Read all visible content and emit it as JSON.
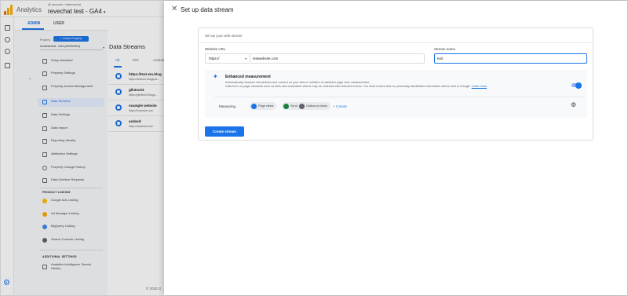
{
  "app": {
    "name": "Analytics",
    "breadcrumb": "All accounts > testrevechat",
    "property_title": "revechat test - GA4",
    "brand_colors": {
      "primary": "#1a73e8",
      "logo_orange": "#f9ab00",
      "logo_dark_orange": "#e37400"
    }
  },
  "admin": {
    "tabs": [
      {
        "label": "ADMIN"
      },
      {
        "label": "USER"
      }
    ],
    "property_label": "Property",
    "create_property_label": "+ Create Property",
    "property_select": "revechat test - GA4 (262351516)",
    "nav_items": [
      {
        "label": "Setup Assistant",
        "icon": "checklist-icon"
      },
      {
        "label": "Property Settings",
        "icon": "settings-doc-icon"
      },
      {
        "label": "Property Access Management",
        "icon": "people-icon"
      },
      {
        "label": "Data Streams",
        "icon": "streams-icon"
      },
      {
        "label": "Data Settings",
        "icon": "data-settings-icon"
      },
      {
        "label": "Data Import",
        "icon": "upload-icon"
      },
      {
        "label": "Reporting Identity",
        "icon": "identity-icon"
      },
      {
        "label": "Attribution Settings",
        "icon": "attribution-icon"
      },
      {
        "label": "Property Change History",
        "icon": "history-icon"
      },
      {
        "label": "Data Deletion Requests",
        "icon": "delete-data-icon"
      }
    ],
    "product_linking_header": "PRODUCT LINKING",
    "product_links": [
      {
        "label": "Google Ads Linking",
        "icon": "google-ads-icon"
      },
      {
        "label": "Ad Manager Linking",
        "icon": "ad-manager-icon"
      },
      {
        "label": "BigQuery Linking",
        "icon": "bigquery-icon"
      },
      {
        "label": "Search Console Linking",
        "icon": "search-console-icon"
      }
    ],
    "additional_settings_header": "ADDITIONAL SETTINGS",
    "additional_items": [
      {
        "label": "Analytics Intelligence Search History",
        "icon": "intelligence-icon"
      }
    ]
  },
  "streams": {
    "title": "Data Streams",
    "tabs": [
      {
        "label": "All"
      },
      {
        "label": "iOS"
      },
      {
        "label": "Android"
      }
    ],
    "rows": [
      {
        "name": "https://test-em.blog",
        "url": "https://testrnm.blogspot..."
      },
      {
        "name": "glintec03",
        "url": "https://glintec03.blogs..."
      },
      {
        "name": "example website",
        "url": "https://example.com"
      },
      {
        "name": "asdasd",
        "url": "https://asdasdd.com"
      }
    ],
    "copyright": "© 2022 G"
  },
  "drawer": {
    "title": "Set up data stream",
    "card_subtitle": "Set up your web stream",
    "website_url_label": "Website URL",
    "protocol": "https://",
    "url_value": "testwebsite.com",
    "stream_name_label": "Stream name",
    "stream_name_value": "test",
    "enhanced": {
      "title": "Enhanced measurement",
      "desc_line1": "Automatically measure interactions and content on your sites in addition to standard page view measurement.",
      "desc_line2": "Data from on-page elements such as links and embedded videos may be collected with relevant events. You must ensure that no personally-identifiable information will be sent to Google.",
      "learn_more": "Learn more",
      "toggle_on": true,
      "measuring_label": "Measuring",
      "chips": [
        {
          "label": "Page views",
          "icon": "eye-icon",
          "color": "#1a73e8"
        },
        {
          "label": "Scrolls",
          "icon": "scroll-icon",
          "color": "#188038"
        },
        {
          "label": "Outbound clicks",
          "icon": "click-icon",
          "color": "#5f6368"
        }
      ],
      "more_label": "+ 3 more"
    },
    "create_button": "Create stream"
  }
}
